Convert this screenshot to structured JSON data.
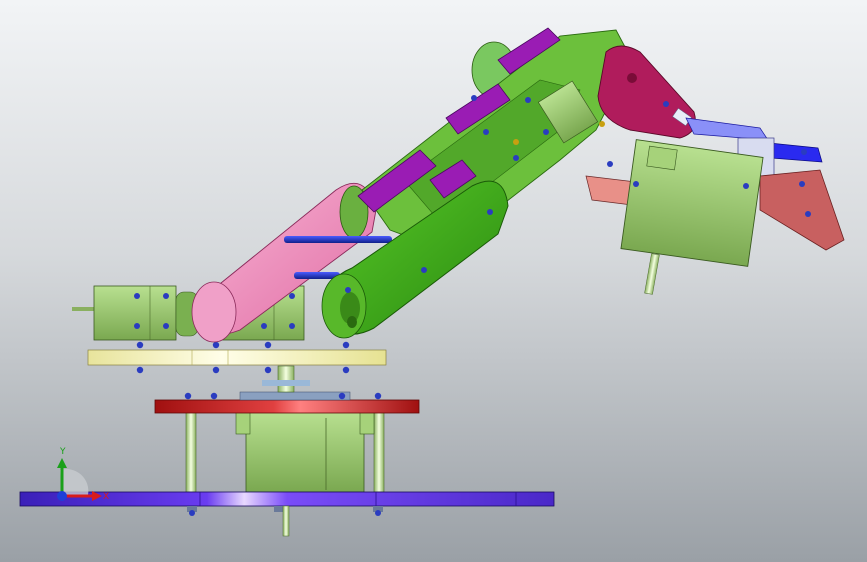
{
  "axes": {
    "y_label": "Y",
    "x_label": "X",
    "y_color": "#1aa01a",
    "x_color": "#d81c1c",
    "z_color": "#1f3fd8"
  },
  "colors": {
    "background_light": "#eef0f2",
    "background_dark": "#9ea4aa",
    "base_plate": "#5a2fd8",
    "turntable": "#c81c1c",
    "upper_plate": "#f2f0b0",
    "servo_green": "#9ccc6a",
    "arm_link_green": "#3fa81a",
    "belt_pink": "#f08cbc",
    "bracket_purple": "#9a1cb4",
    "wrist_magenta": "#b01c5c",
    "gripper_blue": "#2a2af0",
    "gripper_finger": "#c86060",
    "fastener_blue": "#1c3cd0"
  }
}
